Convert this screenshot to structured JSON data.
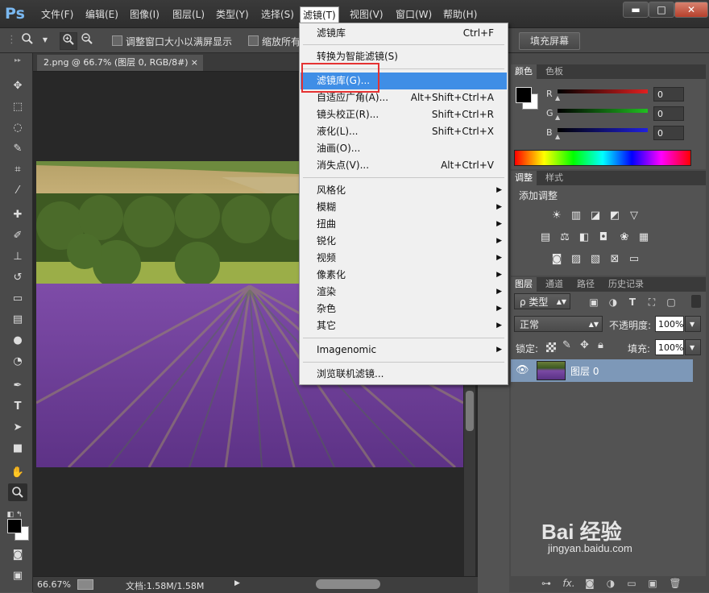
{
  "app": {
    "logo": "Ps"
  },
  "menubar": {
    "items": [
      "文件(F)",
      "编辑(E)",
      "图像(I)",
      "图层(L)",
      "类型(Y)",
      "选择(S)",
      "滤镜(T)",
      "视图(V)",
      "窗口(W)",
      "帮助(H)"
    ],
    "active": "滤镜(T)"
  },
  "window_controls": {
    "minimize": "▬",
    "maximize": "□",
    "close": "✕"
  },
  "options": {
    "zoom_icon": "zoom-icon",
    "resize_windows_label": "调整窗口大小以满屏显示",
    "zoom_all_label": "缩放所有",
    "fill_screen_button": "填充屏幕"
  },
  "document": {
    "tab_title": "2.png @ 66.7% (图层 0, RGB/8#)",
    "tab_close": "×"
  },
  "status": {
    "zoom": "66.67%",
    "doc_size": "文档:1.58M/1.58M",
    "arrow": "▶"
  },
  "filter_menu": {
    "items": [
      {
        "label": "滤镜库",
        "shortcut": "Ctrl+F",
        "submenu": false
      },
      {
        "label": "转换为智能滤镜(S)",
        "shortcut": "",
        "submenu": false
      },
      {
        "label": "滤镜库(G)...",
        "shortcut": "",
        "submenu": false,
        "highlighted": true
      },
      {
        "label": "自适应广角(A)...",
        "shortcut": "Alt+Shift+Ctrl+A",
        "submenu": false
      },
      {
        "label": "镜头校正(R)...",
        "shortcut": "Shift+Ctrl+R",
        "submenu": false
      },
      {
        "label": "液化(L)...",
        "shortcut": "Shift+Ctrl+X",
        "submenu": false
      },
      {
        "label": "油画(O)...",
        "shortcut": "",
        "submenu": false
      },
      {
        "label": "消失点(V)...",
        "shortcut": "Alt+Ctrl+V",
        "submenu": false
      },
      {
        "label": "风格化",
        "shortcut": "",
        "submenu": true
      },
      {
        "label": "模糊",
        "shortcut": "",
        "submenu": true
      },
      {
        "label": "扭曲",
        "shortcut": "",
        "submenu": true
      },
      {
        "label": "锐化",
        "shortcut": "",
        "submenu": true
      },
      {
        "label": "视频",
        "shortcut": "",
        "submenu": true
      },
      {
        "label": "像素化",
        "shortcut": "",
        "submenu": true
      },
      {
        "label": "渲染",
        "shortcut": "",
        "submenu": true
      },
      {
        "label": "杂色",
        "shortcut": "",
        "submenu": true
      },
      {
        "label": "其它",
        "shortcut": "",
        "submenu": true
      },
      {
        "label": "Imagenomic",
        "shortcut": "",
        "submenu": true
      },
      {
        "label": "浏览联机滤镜...",
        "shortcut": "",
        "submenu": false
      }
    ],
    "submenu_arrow": "▶",
    "highlight_color": "#3f8ee6",
    "callout_color": "#e53232"
  },
  "color_panel": {
    "tabs": [
      "颜色",
      "色板"
    ],
    "active_tab": "颜色",
    "channels": [
      {
        "label": "R",
        "value": "0",
        "color": "#e02020"
      },
      {
        "label": "G",
        "value": "0",
        "color": "#20c020"
      },
      {
        "label": "B",
        "value": "0",
        "color": "#2020e0"
      }
    ]
  },
  "adjust_panel": {
    "tabs": [
      "调整",
      "样式"
    ],
    "active_tab": "调整",
    "title": "添加调整",
    "icons": [
      "brightness-icon",
      "levels-icon",
      "curves-icon",
      "exposure-icon",
      "vibrance-icon",
      "hue-saturation-icon",
      "color-balance-icon",
      "black-white-icon",
      "photo-filter-icon",
      "channel-mixer-icon",
      "color-lookup-icon",
      "invert-icon",
      "posterize-icon",
      "threshold-icon",
      "selective-color-icon",
      "gradient-map-icon"
    ]
  },
  "layers_panel": {
    "tabs": [
      "图层",
      "通道",
      "路径",
      "历史记录"
    ],
    "active_tab": "图层",
    "filter_kind": "ρ 类型",
    "blend_mode": "正常",
    "opacity_label": "不透明度:",
    "opacity_value": "100%",
    "lock_label": "锁定:",
    "fill_label": "填充:",
    "fill_value": "100%",
    "layer_name": "图层 0",
    "eye_icon": "eye-icon"
  },
  "watermark": {
    "text": "Bai 经验",
    "url": "jingyan.baidu.com"
  }
}
